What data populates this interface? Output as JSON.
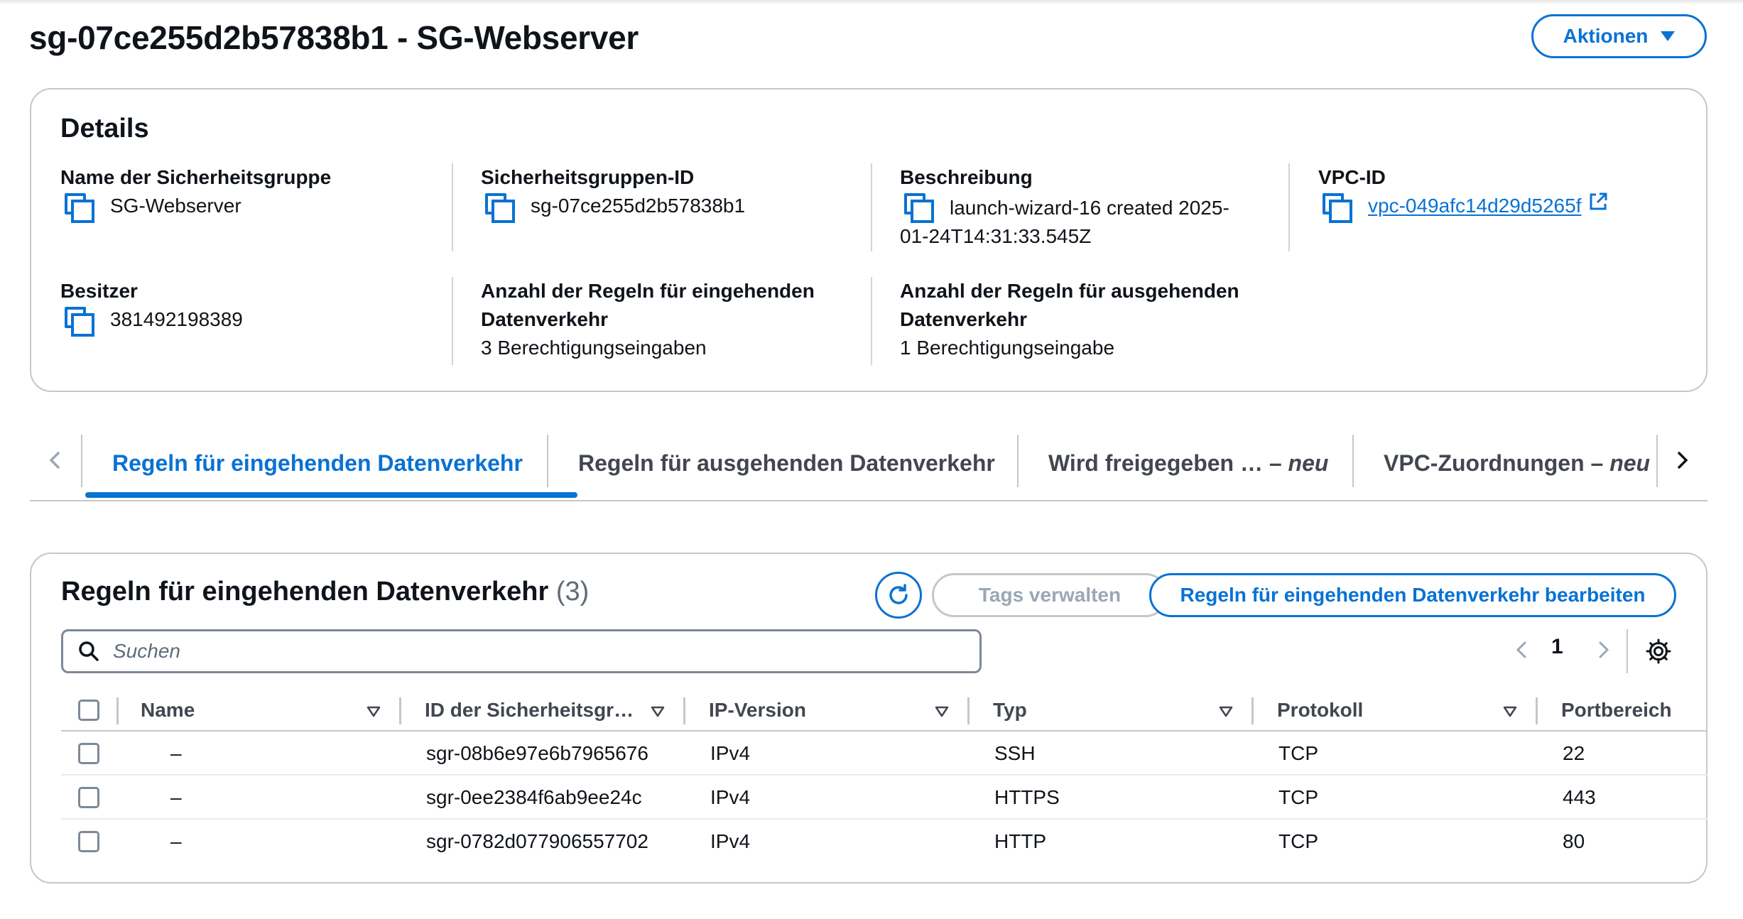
{
  "page": {
    "title": "sg-07ce255d2b57838b1 - SG-Webserver",
    "actions_label": "Aktionen"
  },
  "details": {
    "heading": "Details",
    "fields": {
      "name": {
        "label": "Name der Sicherheitsgruppe",
        "value": "SG-Webserver"
      },
      "sg_id": {
        "label": "Sicherheitsgruppen-ID",
        "value": "sg-07ce255d2b57838b1"
      },
      "description": {
        "label": "Beschreibung",
        "value_line1": "launch-wizard-16 created 2025-",
        "value_line2": "01-24T14:31:33.545Z"
      },
      "vpc_id": {
        "label": "VPC-ID",
        "value": "vpc-049afc14d29d5265f"
      },
      "owner": {
        "label": "Besitzer",
        "value": "381492198389"
      },
      "inbound_count": {
        "label_line1": "Anzahl der Regeln für eingehenden",
        "label_line2": "Datenverkehr",
        "value": "3 Berechtigungseingaben"
      },
      "outbound_count": {
        "label_line1": "Anzahl der Regeln für ausgehenden",
        "label_line2": "Datenverkehr",
        "value": "1 Berechtigungseingabe"
      }
    }
  },
  "tabs": {
    "items": [
      {
        "label": "Regeln für eingehenden Datenverkehr",
        "suffix": ""
      },
      {
        "label": "Regeln für ausgehenden Datenverkehr",
        "suffix": ""
      },
      {
        "label": "Wird freigegeben … – ",
        "suffix": "neu"
      },
      {
        "label": "VPC-Zuordnungen – ",
        "suffix": "neu"
      }
    ],
    "active_index": 0
  },
  "rules": {
    "title": "Regeln für eingehenden Datenverkehr",
    "count": "(3)",
    "tags_button": "Tags verwalten",
    "edit_button": "Regeln für eingehenden Datenverkehr bearbeiten",
    "search_placeholder": "Suchen",
    "page_number": "1",
    "columns": [
      "Name",
      "ID der Sicherheitsgr…",
      "IP-Version",
      "Typ",
      "Protokoll",
      "Portbereich"
    ],
    "rows": [
      {
        "name": "–",
        "id": "sgr-08b6e97e6b7965676",
        "ip_version": "IPv4",
        "type": "SSH",
        "protocol": "TCP",
        "port": "22"
      },
      {
        "name": "–",
        "id": "sgr-0ee2384f6ab9ee24c",
        "ip_version": "IPv4",
        "type": "HTTPS",
        "protocol": "TCP",
        "port": "443"
      },
      {
        "name": "–",
        "id": "sgr-0782d077906557702",
        "ip_version": "IPv4",
        "type": "HTTP",
        "protocol": "TCP",
        "port": "80"
      }
    ]
  },
  "colors": {
    "accent": "#0972d3",
    "border": "#c6c6cd",
    "text": "#0f141a",
    "muted": "#5f6b7a"
  }
}
